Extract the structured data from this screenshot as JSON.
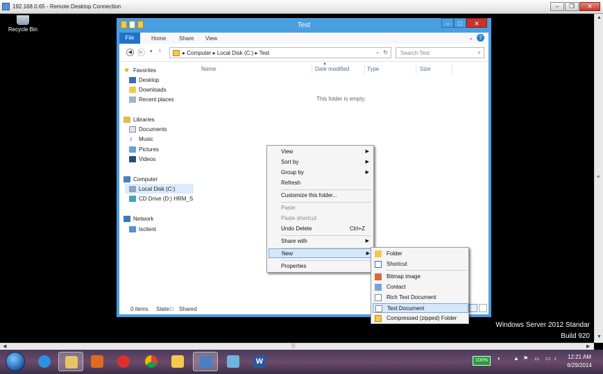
{
  "rdp": {
    "title": "192.168.0.65 - Remote Desktop Connection",
    "buttons": {
      "minimize": "–",
      "restore": "❐",
      "close": "✕"
    }
  },
  "desktop": {
    "recycle_bin": "Recycle Bin",
    "watermark_line1": "Windows Server 2012 Standar",
    "watermark_line2": "Build 920"
  },
  "explorer": {
    "title": "Test",
    "ribbon": {
      "file": "File",
      "tabs": [
        "Home",
        "Share",
        "View"
      ]
    },
    "address": {
      "crumbs": "▸ Computer ▸ Local Disk (C:) ▸ Test",
      "refresh": "↻"
    },
    "search": {
      "placeholder": "Search Test",
      "icon": "⌕"
    },
    "nav": {
      "favorites": "Favorites",
      "desktop": "Desktop",
      "downloads": "Downloads",
      "recent": "Recent places",
      "libraries": "Libraries",
      "documents": "Documents",
      "music": "Music",
      "pictures": "Pictures",
      "videos": "Videos",
      "computer": "Computer",
      "local_disk": "Local Disk (C:)",
      "cd_drive": "CD Drive (D:) HRM_S",
      "network": "Network",
      "tsclient": "tsclient"
    },
    "columns": [
      "Name",
      "Date modified",
      "Type",
      "Size"
    ],
    "empty_text": "This folder is empty.",
    "status": {
      "items": "0 items",
      "state_label": "State:",
      "state_value": "Shared"
    }
  },
  "context_menu": {
    "view": "View",
    "sort_by": "Sort by",
    "group_by": "Group by",
    "refresh": "Refresh",
    "customize": "Customize this folder...",
    "paste": "Paste",
    "paste_shortcut": "Paste shortcut",
    "undo_delete": "Undo Delete",
    "undo_shortcut": "Ctrl+Z",
    "share_with": "Share with",
    "new": "New",
    "properties": "Properties"
  },
  "new_submenu": {
    "folder": "Folder",
    "shortcut": "Shortcut",
    "bitmap": "Bitmap image",
    "contact": "Contact",
    "rtf": "Rich Text Document",
    "text": "Text Document",
    "zip": "Compressed (zipped) Folder"
  },
  "taskbar": {
    "battery": "100%",
    "time": "12:21 AM",
    "date": "6/29/2014",
    "icons": [
      "ie-icon",
      "explorer-icon",
      "media-player-icon",
      "chrome-folder-icon",
      "chrome-icon",
      "folder-icon",
      "remote-desktop-icon",
      "pen-icon",
      "word-icon"
    ]
  },
  "colors": {
    "accent": "#4a9fe0",
    "file_tab": "#1e74c8",
    "highlight": "#d5e7fa",
    "close": "#c7332e"
  }
}
